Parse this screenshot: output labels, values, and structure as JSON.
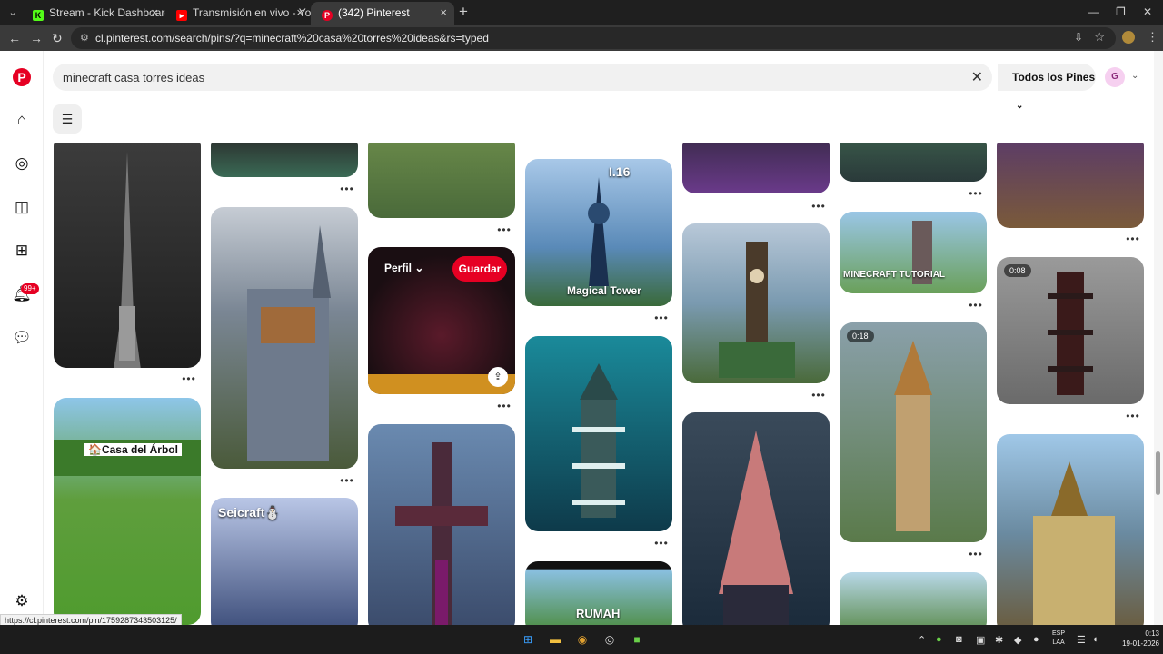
{
  "browser": {
    "tabs": [
      {
        "title": "Stream - Kick Dashboard",
        "favicon": "kick-icon"
      },
      {
        "title": "Transmisión en vivo - YouTube",
        "favicon": "youtube-icon"
      },
      {
        "title": "(342) Pinterest",
        "favicon": "pinterest-icon"
      }
    ],
    "url": "cl.pinterest.com/search/pins/?q=minecraft%20casa%20torres%20ideas&rs=typed"
  },
  "search": {
    "query": "minecraft casa torres ideas",
    "filter_label": "Todos los Pines",
    "avatar_initial": "G"
  },
  "sidebar": {
    "notification_count": "99+"
  },
  "pins": [
    {
      "caption": "",
      "video_time": ""
    },
    {
      "caption": "🏠Casa del Árbol",
      "video_time": ""
    },
    {
      "caption": "",
      "video_time": ""
    },
    {
      "caption": "",
      "video_time": ""
    },
    {
      "caption": "Seicraft⛄",
      "video_time": ""
    },
    {
      "caption": "",
      "video_time": ""
    },
    {
      "caption": "",
      "video_time": ""
    },
    {
      "caption": "",
      "video_time": ""
    },
    {
      "caption": "I.16",
      "video_time": ""
    },
    {
      "caption": "Magical Tower",
      "video_time": ""
    },
    {
      "caption": "",
      "video_time": ""
    },
    {
      "caption": "RUMAH",
      "video_time": ""
    },
    {
      "caption": "",
      "video_time": ""
    },
    {
      "caption": "",
      "video_time": ""
    },
    {
      "caption": "",
      "video_time": ""
    },
    {
      "caption": "",
      "video_time": ""
    },
    {
      "caption": "MINECRAFT TUTORIAL",
      "video_time": ""
    },
    {
      "caption": "",
      "video_time": "0:18"
    },
    {
      "caption": "",
      "video_time": ""
    },
    {
      "caption": "",
      "video_time": ""
    },
    {
      "caption": "",
      "video_time": "0:08"
    },
    {
      "caption": "",
      "video_time": ""
    }
  ],
  "hover_pin": {
    "profile_label": "Perfil",
    "save_label": "Guardar"
  },
  "status_url": "https://cl.pinterest.com/pin/1759287343503125/",
  "taskbar": {
    "lang_line1": "ESP",
    "lang_line2": "LAA",
    "time": "0:13",
    "date": "19-01-2026"
  }
}
